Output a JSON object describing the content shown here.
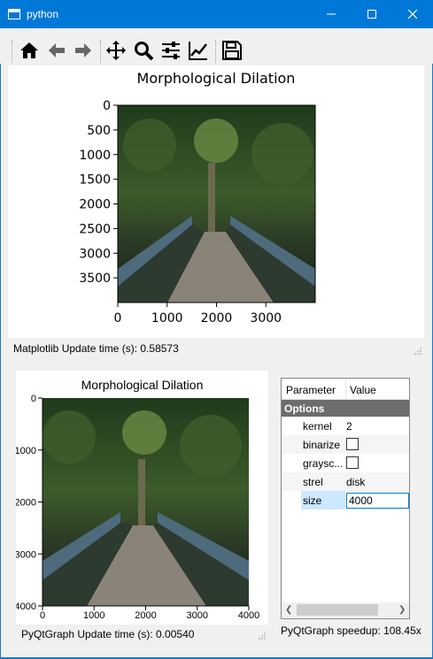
{
  "window": {
    "title": "python",
    "accent": "#0078d7"
  },
  "toolbar": {
    "tools": [
      {
        "name": "home-icon"
      },
      {
        "name": "back-arrow-icon"
      },
      {
        "name": "forward-arrow-icon"
      },
      {
        "name": "pan-move-icon"
      },
      {
        "name": "zoom-magnifier-icon"
      },
      {
        "name": "subplots-config-icon"
      },
      {
        "name": "edit-axis-icon"
      },
      {
        "name": "save-floppy-icon"
      }
    ]
  },
  "matplotlib": {
    "title": "Morphological Dilation",
    "y_ticks": [
      "0",
      "500",
      "1000",
      "1500",
      "2000",
      "2500",
      "3000",
      "3500"
    ],
    "x_ticks": [
      "0",
      "1000",
      "2000",
      "3000"
    ],
    "status": "Matplotlib Update time (s): 0.58573"
  },
  "pyqtgraph": {
    "title": "Morphological Dilation",
    "y_ticks": [
      "0",
      "1000",
      "2000",
      "3000",
      "4000"
    ],
    "x_ticks": [
      "0",
      "1000",
      "2000",
      "3000",
      "4000"
    ],
    "status": "PyQtGraph Update time (s): 0.00540"
  },
  "params": {
    "col_parameter": "Parameter",
    "col_value": "Value",
    "group": "Options",
    "kernel_label": "kernel",
    "kernel_value": "2",
    "binarize_label": "binarize",
    "grayscale_label": "graysc...",
    "strel_label": "strel",
    "strel_value": "disk",
    "size_label": "size",
    "size_value": "4000"
  },
  "speedup": "PyQtGraph speedup: 108.45x"
}
